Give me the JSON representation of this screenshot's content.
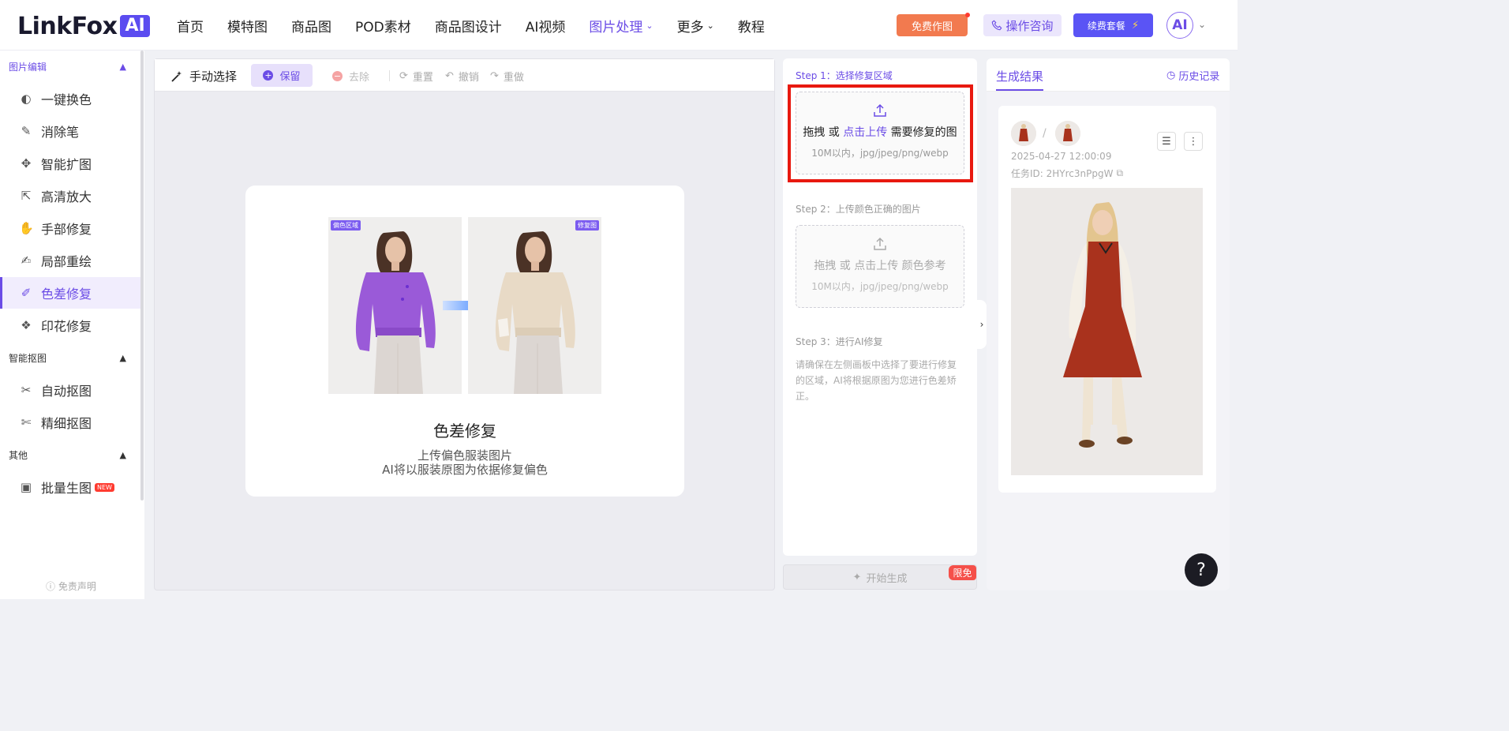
{
  "header": {
    "logo_text": "LinkFox",
    "logo_badge": "AI",
    "nav": [
      {
        "label": "首页"
      },
      {
        "label": "模特图"
      },
      {
        "label": "商品图"
      },
      {
        "label": "POD素材"
      },
      {
        "label": "商品图设计"
      },
      {
        "label": "AI视频"
      },
      {
        "label": "图片处理",
        "active": true,
        "dropdown": true
      },
      {
        "label": "更多",
        "dropdown": true
      },
      {
        "label": "教程"
      }
    ],
    "free_button": "免费作图",
    "consult_button": "操作咨询",
    "renew_button": "续费套餐",
    "avatar_text": "AI"
  },
  "sidebar": {
    "sections": [
      {
        "title": "图片编辑"
      },
      {
        "title": "智能抠图"
      },
      {
        "title": "其他"
      }
    ],
    "items": [
      {
        "label": "一键换色",
        "icon": "palette-icon"
      },
      {
        "label": "消除笔",
        "icon": "eraser-icon"
      },
      {
        "label": "智能扩图",
        "icon": "expand-icon"
      },
      {
        "label": "高清放大",
        "icon": "upscale-icon"
      },
      {
        "label": "手部修复",
        "icon": "hand-icon"
      },
      {
        "label": "局部重绘",
        "icon": "brush-icon"
      },
      {
        "label": "色差修复",
        "icon": "color-fix-icon",
        "active": true
      },
      {
        "label": "印花修复",
        "icon": "print-icon"
      },
      {
        "label": "自动抠图",
        "icon": "auto-cutout-icon"
      },
      {
        "label": "精细抠图",
        "icon": "fine-cutout-icon"
      },
      {
        "label": "批量生图",
        "icon": "image-batch-icon",
        "badge": "NEW"
      }
    ],
    "disclaimer": "免责声明"
  },
  "toolbar": {
    "manual_select": "手动选择",
    "keep": "保留",
    "remove": "去除",
    "reset": "重置",
    "undo": "撤销",
    "redo": "重做"
  },
  "demo": {
    "tag_left": "偏色区域",
    "tag_right": "修复图",
    "title": "色差修复",
    "subtitle_line1": "上传偏色服装图片",
    "subtitle_line2": "AI将以服装原图为依据修复偏色"
  },
  "steps": {
    "step1_label": "Step 1：选择修复区域",
    "step1_upload_prefix": "拖拽 或 ",
    "step1_upload_link": "点击上传",
    "step1_upload_suffix": " 需要修复的图",
    "step1_hint": "10M以内，jpg/jpeg/png/webp",
    "step2_label": "Step 2：上传颜色正确的图片",
    "step2_upload_prefix": "拖拽 或 ",
    "step2_upload_link": "点击上传",
    "step2_upload_suffix": " 颜色参考",
    "step2_hint": "10M以内，jpg/jpeg/png/webp",
    "step3_label": "Step 3：进行AI修复",
    "step3_desc": "请确保在左侧画板中选择了要进行修复的区域，AI将根据原图为您进行色差矫正。"
  },
  "generate": {
    "button": "开始生成",
    "badge": "限免"
  },
  "result": {
    "tab": "生成结果",
    "history": "历史记录",
    "date": "2025-04-27 12:00:09",
    "task_id": "任务ID: 2HYrc3nPpgW",
    "separator": "/"
  },
  "help": "?",
  "colors": {
    "accent": "#6b4ce6",
    "free_button": "#f27a4f",
    "renew_button": "#5a54f5",
    "highlight_border": "#e8190f",
    "limit_badge": "#f5504a"
  }
}
